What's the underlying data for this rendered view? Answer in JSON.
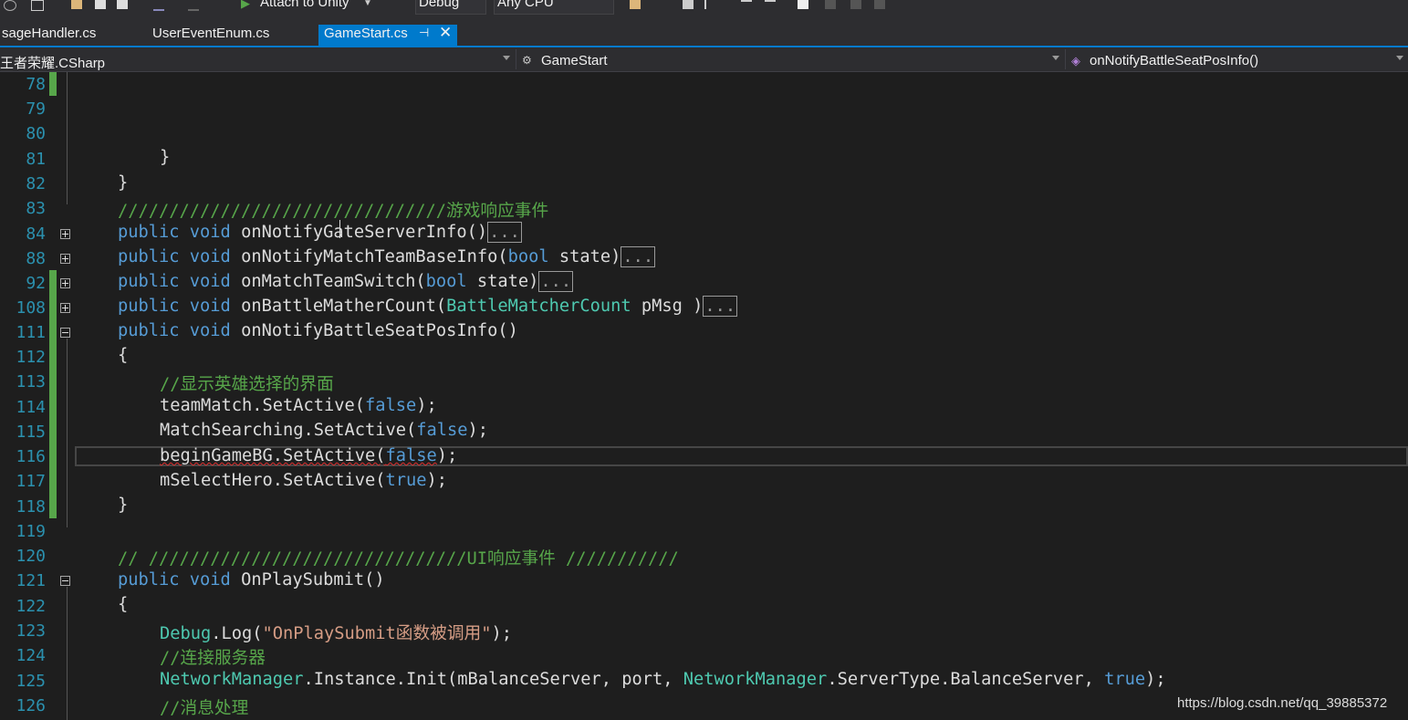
{
  "toolbar": {
    "attach_label": "Attach to Unity",
    "config_value": "Debug",
    "platform_value": "Any CPU"
  },
  "tabs": [
    {
      "label": "sageHandler.cs"
    },
    {
      "label": "UserEventEnum.cs"
    },
    {
      "label": "GameStart.cs",
      "active": true
    }
  ],
  "nav": {
    "project": "王者荣耀.CSharp",
    "class": "GameStart",
    "member": "onNotifyBattleSeatPosInfo()"
  },
  "line_numbers": [
    "78",
    "79",
    "80",
    "81",
    "82",
    "83",
    "84",
    "88",
    "92",
    "108",
    "111",
    "112",
    "113",
    "114",
    "115",
    "116",
    "117",
    "118",
    "119",
    "120",
    "121",
    "122",
    "123",
    "124",
    "125",
    "126"
  ],
  "code": {
    "l81": "}",
    "l82": "}",
    "l83": "////////////////////////////////游戏响应事件",
    "kw_public": "public",
    "kw_void": "void",
    "kw_bool": "bool",
    "kw_false": "false",
    "kw_true": "true",
    "collapsed": "...",
    "l84_name": "onNotifyGateServerInfo()",
    "l88_name": "onNotifyMatchTeamBaseInfo(",
    "l88_param": " state)",
    "l92_name": "onMatchTeamSwitch(",
    "l92_param": " state)",
    "l108_name": "onBattleMatherCount(",
    "l108_type": "BattleMatcherCount",
    "l108_param": " pMsg )",
    "l111_name": "onNotifyBattleSeatPosInfo()",
    "brace_open": "{",
    "brace_close": "}",
    "l113": "//显示英雄选择的界面",
    "l114_pre": "teamMatch.SetActive(",
    "l115_pre": "MatchSearching.SetActive(",
    "l116_pre": "beginGameBG.SetActive(",
    "l117_pre": "mSelectHero.SetActive(",
    "close_paren": ");",
    "l120": "// ///////////////////////////////UI响应事件 ///////////",
    "l121_name": "OnPlaySubmit()",
    "l123_type": "Debug",
    "l123_mid": ".Log(",
    "l123_str": "\"OnPlaySubmit函数被调用\"",
    "l124": "//连接服务器",
    "l125_type1": "NetworkManager",
    "l125_mid": ".Instance.Init(mBalanceServer, port, ",
    "l125_type2": "NetworkManager",
    "l125_mid2": ".ServerType.BalanceServer, ",
    "l126": "//消息处理"
  },
  "watermark": "https://blog.csdn.net/qq_39885372",
  "colors": {
    "keyword": "#569cd6",
    "type": "#4ec9b0",
    "comment": "#57a64a",
    "string": "#d69d85",
    "line_number": "#2b91af",
    "accent": "#007acc"
  }
}
